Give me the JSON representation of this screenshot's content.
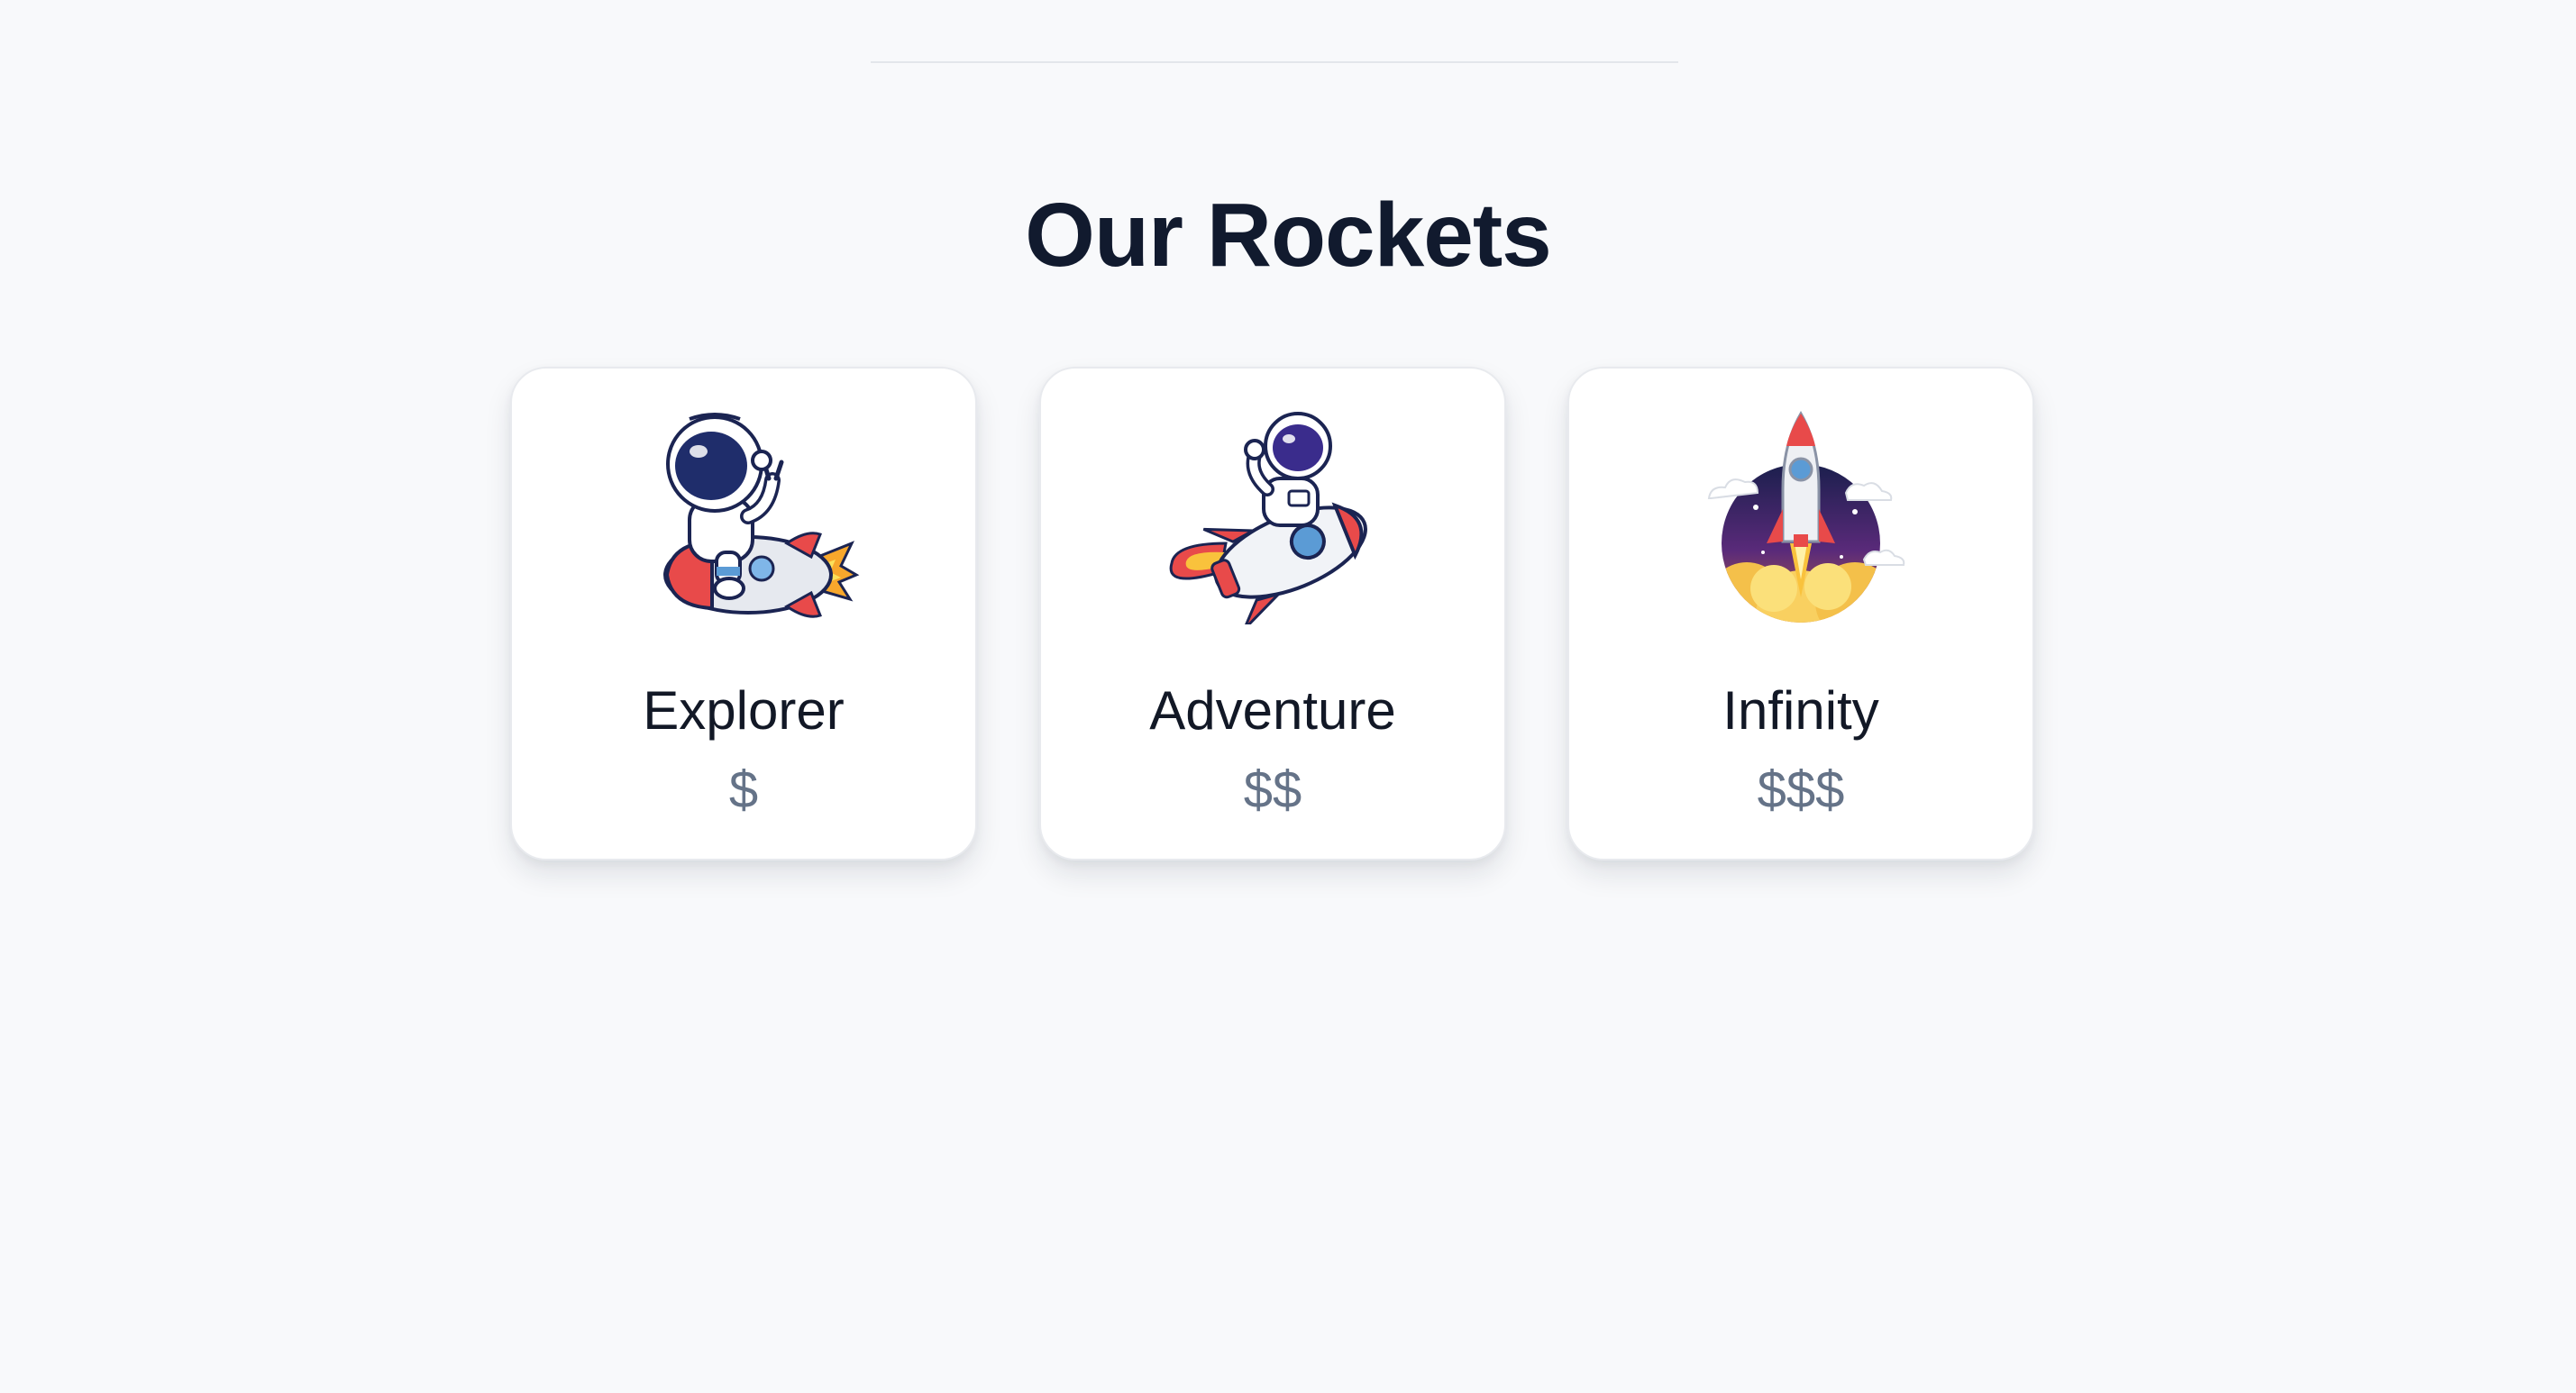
{
  "section": {
    "title": "Our Rockets"
  },
  "rockets": [
    {
      "name": "Explorer",
      "price": "$",
      "image_icon": "astronaut-riding-rocket-icon"
    },
    {
      "name": "Adventure",
      "price": "$$",
      "image_icon": "astronaut-waving-on-rocket-icon"
    },
    {
      "name": "Infinity",
      "price": "$$$",
      "image_icon": "rocket-launch-badge-icon"
    }
  ],
  "colors": {
    "background": "#f8f9fb",
    "heading": "#111a2e",
    "card_title": "#121826",
    "price": "#657388",
    "rocket_red": "#e84a4a",
    "astronaut_navy": "#1f2d6b",
    "flame_yellow": "#f9c23c"
  }
}
